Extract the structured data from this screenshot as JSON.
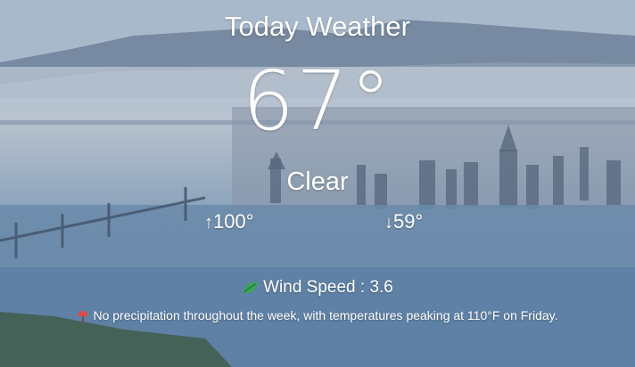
{
  "header": {
    "title": "Today Weather"
  },
  "current": {
    "temperature": "67°",
    "condition": "Clear"
  },
  "range": {
    "high_arrow": "↑",
    "high": "100°",
    "low_arrow": "↓",
    "low": "59°"
  },
  "wind": {
    "label": "Wind Speed : 3.6",
    "icon": "leaf-icon"
  },
  "forecast": {
    "summary": "No precipitation throughout the week, with temperatures peaking at 110°F on Friday.",
    "icon": "umbrella-icon"
  },
  "colors": {
    "text": "#ffffff",
    "leaf": "#3aa55a",
    "umbrella": "#d94b4b"
  }
}
